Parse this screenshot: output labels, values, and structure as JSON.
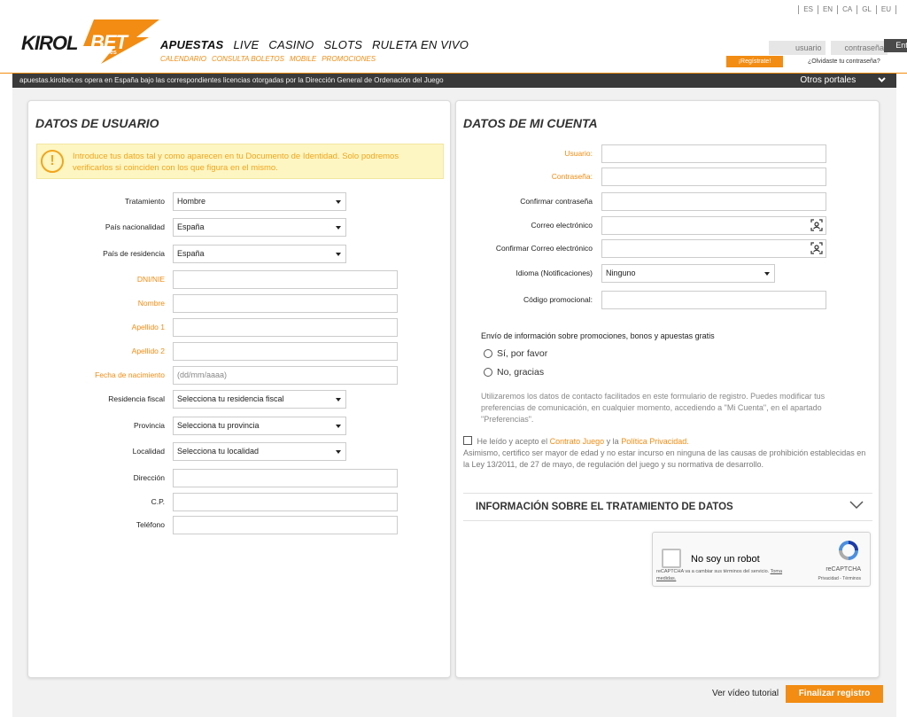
{
  "header": {
    "languages": [
      "ES",
      "EN",
      "CA",
      "GL",
      "EU"
    ],
    "logo": {
      "part1": "KIROL",
      "part2": "BET",
      "sub": ".es"
    },
    "main_nav": [
      "APUESTAS",
      "LIVE",
      "CASINO",
      "SLOTS",
      "RULETA EN VIVO"
    ],
    "sub_nav": [
      "CALENDARIO",
      "CONSULTA BOLETOS",
      "MOBILE",
      "PROMOCIONES"
    ],
    "login": {
      "user_placeholder": "usuario",
      "password_placeholder": "contraseña",
      "enter_label": "Entrar",
      "register_label": "¡Regístrate!",
      "forgot_label": "¿Olvidaste tu contraseña?"
    }
  },
  "license_bar": {
    "text": "apuestas.kirolbet.es opera en España bajo las correspondientes licencias otorgadas por la Dirección General de Ordenación del Juego",
    "other_portals": "Otros portales"
  },
  "user_data": {
    "title": "DATOS DE USUARIO",
    "warning": "Introduce tus datos tal y como aparecen en tu Documento de Identidad. Solo podremos verificarlos si coinciden con los que figura en el mismo.",
    "fields": [
      {
        "label": "Tratamiento",
        "value": "Hombre",
        "type": "select",
        "required": false
      },
      {
        "label": "País nacionalidad",
        "value": "España",
        "type": "select",
        "required": false
      },
      {
        "label": "País de residencia",
        "value": "España",
        "type": "select",
        "required": false
      },
      {
        "label": "DNI/NIE",
        "value": "",
        "type": "text",
        "required": true
      },
      {
        "label": "Nombre",
        "value": "",
        "type": "text",
        "required": true
      },
      {
        "label": "Apellido 1",
        "value": "",
        "type": "text",
        "required": true
      },
      {
        "label": "Apellido 2",
        "value": "",
        "type": "text",
        "required": true
      },
      {
        "label": "Fecha de nacimiento",
        "value": "(dd/mm/aaaa)",
        "type": "text",
        "required": true
      },
      {
        "label": "Residencia fiscal",
        "value": "Selecciona tu residencia fiscal",
        "type": "select",
        "required": false
      },
      {
        "label": "Provincia",
        "value": "Selecciona tu provincia",
        "type": "select",
        "required": false
      },
      {
        "label": "Localidad",
        "value": "Selecciona tu localidad",
        "type": "select",
        "required": false
      },
      {
        "label": "Dirección",
        "value": "",
        "type": "text",
        "required": false
      },
      {
        "label": "C.P.",
        "value": "",
        "type": "text",
        "required": false
      },
      {
        "label": "Teléfono",
        "value": "",
        "type": "text",
        "required": false
      }
    ]
  },
  "account_data": {
    "title": "DATOS DE MI CUENTA",
    "fields": [
      {
        "label": "Usuario:",
        "value": "",
        "required": true
      },
      {
        "label": "Contraseña:",
        "value": "",
        "required": true
      },
      {
        "label": "Confirmar contraseña",
        "value": "",
        "required": false
      },
      {
        "label": "Correo electrónico",
        "value": "",
        "required": false
      },
      {
        "label": "Confirmar Correo electrónico",
        "value": "",
        "required": false
      },
      {
        "label": "Idioma (Notificaciones)",
        "value": "Ninguno",
        "required": false
      },
      {
        "label": "Código promocional:",
        "value": "",
        "required": false
      }
    ],
    "promo_title": "Envío de información sobre promociones, bonos y apuestas gratis",
    "promo_yes": "Sí, por favor",
    "promo_no": "No, gracias",
    "promo_note": "Utilizaremos los datos de contacto facilitados en este formulario de registro. Puedes modificar tus preferencias de comunicación, en cualquier momento, accediendo a \"Mi Cuenta\", en el apartado \"Preferencias\".",
    "terms_prefix": "He leído y acepto el",
    "terms_link1": "Contrato Juego",
    "terms_and": "y la",
    "terms_link2": "Política Privacidad.",
    "terms_rest": "Asimismo, certifico ser mayor de edad y no estar incurso en ninguna de las causas de prohibición establecidas en la Ley 13/2011, de 27 de mayo, de regulación del juego y su normativa de desarrollo.",
    "info_title": "INFORMACIÓN SOBRE EL TRATAMIENTO DE DATOS",
    "captcha": {
      "label": "No soy un robot",
      "brand": "reCAPTCHA",
      "links": "Privacidad - Términos",
      "notice": "reCAPTCHA va a cambiar sus términos del servicio.",
      "notice_link": "Toma medidas."
    }
  },
  "footer": {
    "video_label": "Ver vídeo tutorial",
    "finish_label": "Finalizar registro"
  },
  "colors": {
    "accent": "#f28c12",
    "dark_bar": "#3a3a3a",
    "warning_bg": "#fdf6c3"
  }
}
